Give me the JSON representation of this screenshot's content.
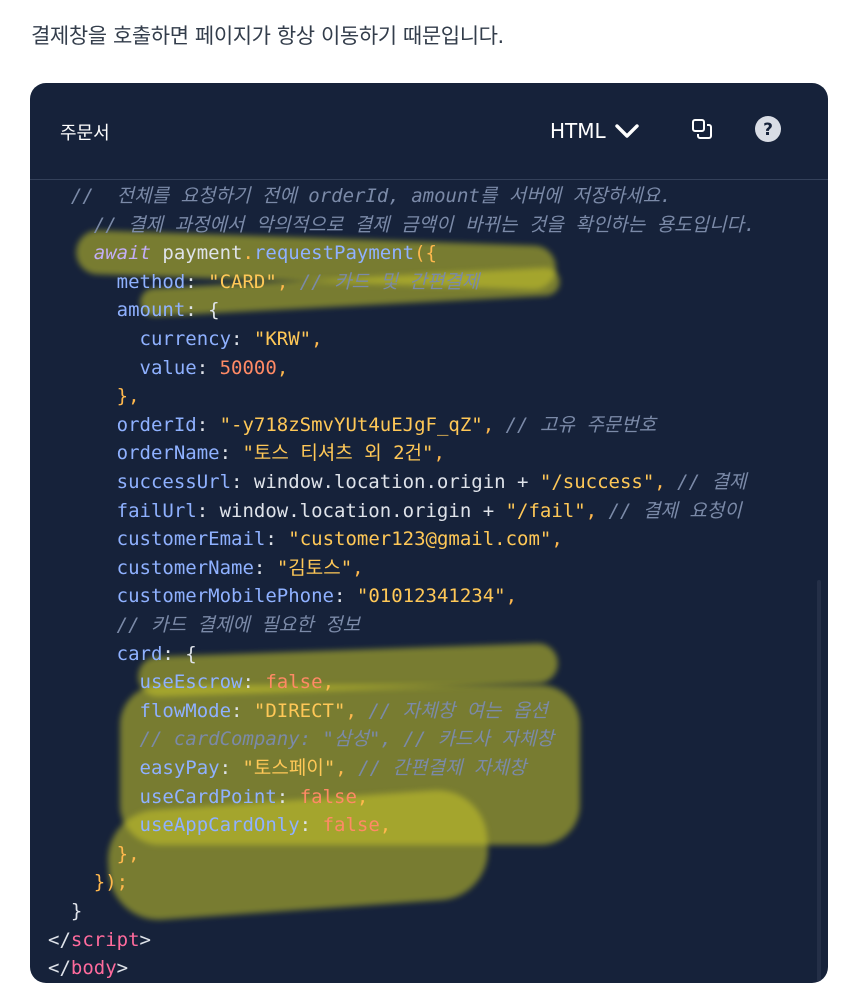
{
  "intro_text": "결제창을 호출하면 페이지가 항상 이동하기 때문입니다.",
  "header": {
    "title": "주문서",
    "language": "HTML"
  },
  "icons": {
    "language": "chevron-down-icon",
    "copy": "copy-icon",
    "help": "help-icon"
  },
  "colors": {
    "background": "#16223a",
    "plain": "#dfe3ea",
    "keyword": "#c3aef7",
    "prop": "#8fb1ff",
    "string": "#ffc857",
    "number": "#ff8a65",
    "comment": "#7b8aa8",
    "punct": "#ffb84d",
    "bool": "#ff8a65",
    "tag": "#ff6b9d"
  },
  "code_lines": [
    [
      [
        "  //  전체를 요청하기 전에 orderId, amount를 서버에 저장하세요.",
        "comment"
      ]
    ],
    [
      [
        "    // 결제 과정에서 악의적으로 결제 금액이 바뀌는 것을 확인하는 용도입니다.",
        "comment"
      ]
    ],
    [
      [
        "    ",
        "plain"
      ],
      [
        "await",
        "keyword"
      ],
      [
        " payment",
        "plain"
      ],
      [
        ".",
        "punct"
      ],
      [
        "requestPayment",
        "prop"
      ],
      [
        "({",
        "punct"
      ]
    ],
    [
      [
        "      ",
        "plain"
      ],
      [
        "method",
        "prop"
      ],
      [
        ": ",
        "plain"
      ],
      [
        "\"CARD\"",
        "string"
      ],
      [
        ",",
        "punct"
      ],
      [
        " // 카드 및 간편결제",
        "comment"
      ]
    ],
    [
      [
        "      ",
        "plain"
      ],
      [
        "amount",
        "prop"
      ],
      [
        ": {",
        "plain"
      ]
    ],
    [
      [
        "        ",
        "plain"
      ],
      [
        "currency",
        "prop"
      ],
      [
        ": ",
        "plain"
      ],
      [
        "\"KRW\"",
        "string"
      ],
      [
        ",",
        "punct"
      ]
    ],
    [
      [
        "        ",
        "plain"
      ],
      [
        "value",
        "prop"
      ],
      [
        ": ",
        "plain"
      ],
      [
        "50000",
        "number"
      ],
      [
        ",",
        "punct"
      ]
    ],
    [
      [
        "      ",
        "plain"
      ],
      [
        "},",
        "punct"
      ]
    ],
    [
      [
        "      ",
        "plain"
      ],
      [
        "orderId",
        "prop"
      ],
      [
        ": ",
        "plain"
      ],
      [
        "\"-y718zSmvYUt4uEJgF_qZ\"",
        "string"
      ],
      [
        ",",
        "punct"
      ],
      [
        " // 고유 주문번호",
        "comment"
      ]
    ],
    [
      [
        "      ",
        "plain"
      ],
      [
        "orderName",
        "prop"
      ],
      [
        ": ",
        "plain"
      ],
      [
        "\"토스 티셔츠 외 2건\"",
        "string"
      ],
      [
        ",",
        "punct"
      ]
    ],
    [
      [
        "      ",
        "plain"
      ],
      [
        "successUrl",
        "prop"
      ],
      [
        ": window.location.origin + ",
        "plain"
      ],
      [
        "\"/success\"",
        "string"
      ],
      [
        ",",
        "punct"
      ],
      [
        " // 결제",
        "comment"
      ]
    ],
    [
      [
        "      ",
        "plain"
      ],
      [
        "failUrl",
        "prop"
      ],
      [
        ": window.location.origin + ",
        "plain"
      ],
      [
        "\"/fail\"",
        "string"
      ],
      [
        ",",
        "punct"
      ],
      [
        " // 결제 요청이 ",
        "comment"
      ]
    ],
    [
      [
        "      ",
        "plain"
      ],
      [
        "customerEmail",
        "prop"
      ],
      [
        ": ",
        "plain"
      ],
      [
        "\"customer123@gmail.com\"",
        "string"
      ],
      [
        ",",
        "punct"
      ]
    ],
    [
      [
        "      ",
        "plain"
      ],
      [
        "customerName",
        "prop"
      ],
      [
        ": ",
        "plain"
      ],
      [
        "\"김토스\"",
        "string"
      ],
      [
        ",",
        "punct"
      ]
    ],
    [
      [
        "      ",
        "plain"
      ],
      [
        "customerMobilePhone",
        "prop"
      ],
      [
        ": ",
        "plain"
      ],
      [
        "\"01012341234\"",
        "string"
      ],
      [
        ",",
        "punct"
      ]
    ],
    [
      [
        "      ",
        "plain"
      ],
      [
        "// 카드 결제에 필요한 정보",
        "comment"
      ]
    ],
    [
      [
        "      ",
        "plain"
      ],
      [
        "card",
        "prop"
      ],
      [
        ": {",
        "plain"
      ]
    ],
    [
      [
        "        ",
        "plain"
      ],
      [
        "useEscrow",
        "prop"
      ],
      [
        ": ",
        "plain"
      ],
      [
        "false",
        "bool"
      ],
      [
        ",",
        "punct"
      ]
    ],
    [
      [
        "        ",
        "plain"
      ],
      [
        "flowMode",
        "prop"
      ],
      [
        ": ",
        "plain"
      ],
      [
        "\"DIRECT\"",
        "string"
      ],
      [
        ",",
        "punct"
      ],
      [
        " // 자체창 여는 옵션",
        "comment"
      ]
    ],
    [
      [
        "        ",
        "plain"
      ],
      [
        "// cardCompany: \"삼성\", // 카드사 자체창",
        "comment"
      ]
    ],
    [
      [
        "        ",
        "plain"
      ],
      [
        "easyPay",
        "prop"
      ],
      [
        ": ",
        "plain"
      ],
      [
        "\"토스페이\"",
        "string"
      ],
      [
        ",",
        "punct"
      ],
      [
        " // 간편결제 자체창",
        "comment"
      ]
    ],
    [
      [
        "        ",
        "plain"
      ],
      [
        "useCardPoint",
        "prop"
      ],
      [
        ": ",
        "plain"
      ],
      [
        "false",
        "bool"
      ],
      [
        ",",
        "punct"
      ]
    ],
    [
      [
        "        ",
        "plain"
      ],
      [
        "useAppCardOnly",
        "prop"
      ],
      [
        ": ",
        "plain"
      ],
      [
        "false",
        "bool"
      ],
      [
        ",",
        "punct"
      ]
    ],
    [
      [
        "      ",
        "plain"
      ],
      [
        "},",
        "punct"
      ]
    ],
    [
      [
        "    ",
        "plain"
      ],
      [
        "});",
        "punct"
      ]
    ],
    [
      [
        "  }",
        "plain"
      ]
    ],
    [
      [
        "</",
        "plain"
      ],
      [
        "script",
        "tag"
      ],
      [
        ">",
        "plain"
      ]
    ],
    [
      [
        "</",
        "plain"
      ],
      [
        "body",
        "tag"
      ],
      [
        ">",
        "plain"
      ]
    ]
  ]
}
